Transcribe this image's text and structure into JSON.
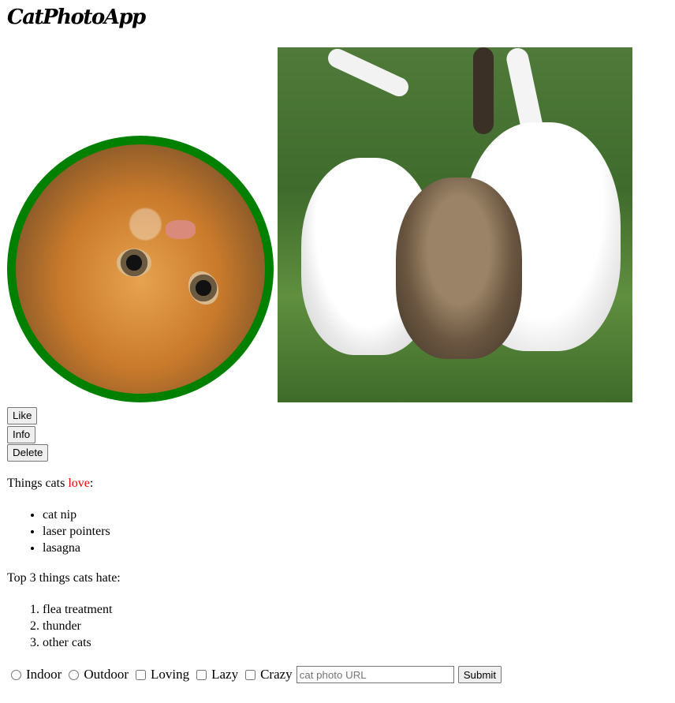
{
  "app": {
    "title": "CatPhotoApp"
  },
  "images": {
    "relaxing_cat": {
      "alt": "cat photo"
    },
    "kittens": {
      "alt": "three kittens"
    }
  },
  "buttons": {
    "like": "Like",
    "info": "Info",
    "delete": "Delete"
  },
  "love": {
    "heading_prefix": "Things cats ",
    "heading_highlight": "love",
    "heading_suffix": ":",
    "items": [
      "cat nip",
      "laser pointers",
      "lasagna"
    ]
  },
  "hate": {
    "heading": "Top 3 things cats hate:",
    "items": [
      "flea treatment",
      "thunder",
      "other cats"
    ]
  },
  "form": {
    "radios": [
      "Indoor",
      "Outdoor"
    ],
    "checkboxes": [
      "Loving",
      "Lazy",
      "Crazy"
    ],
    "url_placeholder": "cat photo URL",
    "submit_label": "Submit"
  },
  "colors": {
    "accent_border": "#008000",
    "highlight_text": "#ff0000"
  }
}
